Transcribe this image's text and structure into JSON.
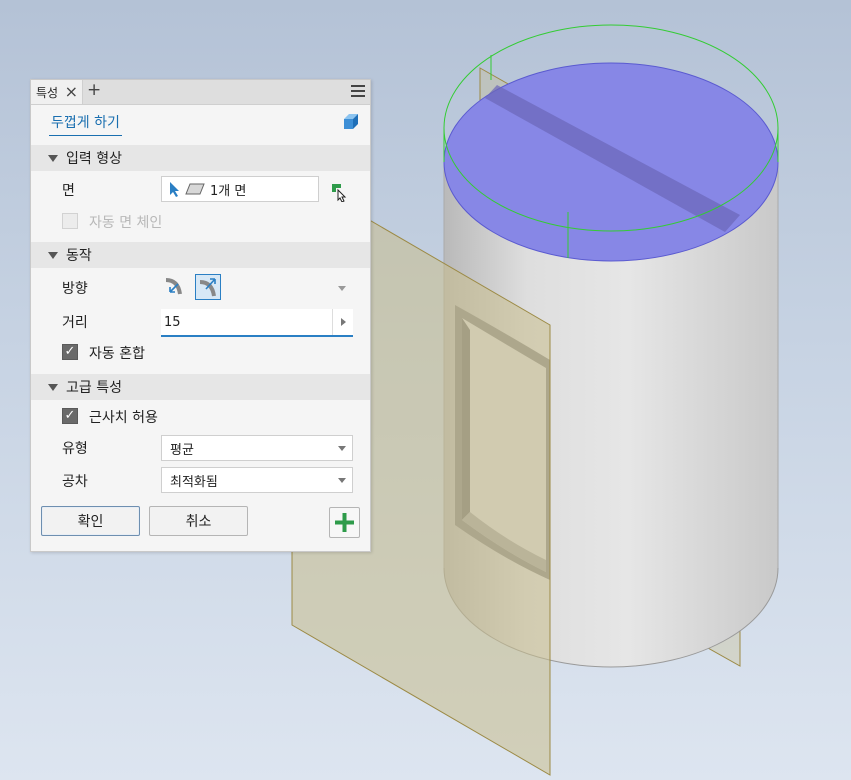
{
  "panel": {
    "tab_label": "특성",
    "command_title": "두껍게 하기",
    "sections": {
      "input_geometry": "입력 형상",
      "behavior": "동작",
      "advanced": "고급 특성"
    },
    "face": {
      "label": "면",
      "value": "1개 면"
    },
    "auto_face_chain": {
      "label": "자동 면 체인",
      "checked": false,
      "enabled": false
    },
    "direction": {
      "label": "방향"
    },
    "distance": {
      "label": "거리",
      "value": "15"
    },
    "auto_blend": {
      "label": "자동 혼합",
      "checked": true
    },
    "allow_approx": {
      "label": "근사치 허용",
      "checked": true
    },
    "type": {
      "label": "유형",
      "value": "평균"
    },
    "tolerance": {
      "label": "공차",
      "value": "최적화됨"
    },
    "buttons": {
      "ok": "확인",
      "cancel": "취소"
    }
  },
  "colors": {
    "accent": "#1a6fb0",
    "top_face_highlight": "#8787e6",
    "preview_outline": "#33cc33",
    "plane": "#c8be8c"
  }
}
